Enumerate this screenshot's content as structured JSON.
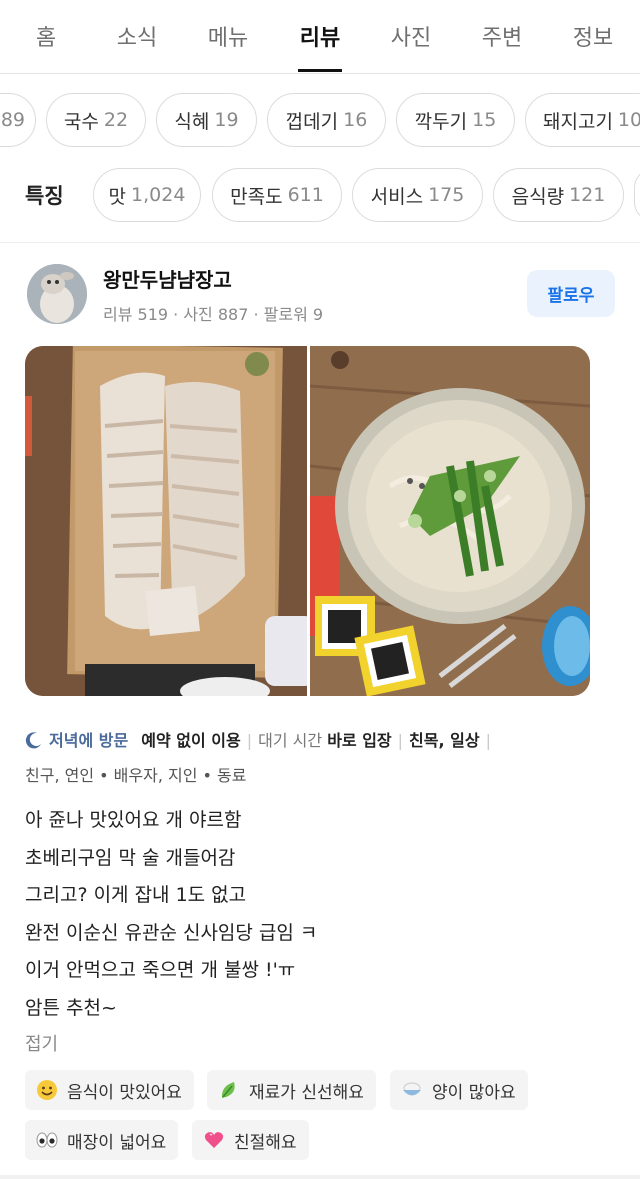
{
  "tabs": [
    {
      "label": "홈"
    },
    {
      "label": "소식"
    },
    {
      "label": "메뉴"
    },
    {
      "label": "리뷰",
      "active": true
    },
    {
      "label": "사진"
    },
    {
      "label": "주변"
    },
    {
      "label": "정보"
    }
  ],
  "menu_chips": [
    {
      "label": "",
      "count": "89"
    },
    {
      "label": "국수",
      "count": "22"
    },
    {
      "label": "식혜",
      "count": "19"
    },
    {
      "label": "껍데기",
      "count": "16"
    },
    {
      "label": "깍두기",
      "count": "15"
    },
    {
      "label": "돼지고기",
      "count": "10"
    }
  ],
  "features": {
    "label": "특징",
    "chips": [
      {
        "label": "맛",
        "count": "1,024"
      },
      {
        "label": "만족도",
        "count": "611"
      },
      {
        "label": "서비스",
        "count": "175"
      },
      {
        "label": "음식량",
        "count": "121"
      }
    ]
  },
  "review": {
    "author": {
      "name": "왕만두냠냠장고",
      "stats": "리뷰 519 · 사진 887 · 팔로워 9"
    },
    "follow_label": "팔로우",
    "visit": {
      "time": "저녁에 방문",
      "reservation": "예약 없이 이용",
      "wait_label": "대기 시간",
      "wait_value": "바로 입장",
      "purpose": "친목, 일상",
      "company": "친구, 연인 • 배우자, 지인 • 동료"
    },
    "text_lines": [
      "아 쥰나 맛있어요 개 야르함",
      "초베리구임 막 술 개들어감",
      "그리고? 이게 잡내 1도 없고",
      "완전 이순신 유관순 신사임당 급임 ㅋ",
      "이거 안먹으고 죽으면 개 불쌍 !'ㅠ",
      "암튼 추천~"
    ],
    "collapse_label": "접기",
    "keywords": [
      {
        "icon": "smile-emoji-icon",
        "label": "음식이 맛있어요"
      },
      {
        "icon": "leaf-icon",
        "label": "재료가 신선해요"
      },
      {
        "icon": "rice-bowl-icon",
        "label": "양이 많아요"
      },
      {
        "icon": "eyes-icon",
        "label": "매장이 넓어요"
      },
      {
        "icon": "heart-icon",
        "label": "친절해요"
      }
    ]
  },
  "colors": {
    "accent": "#1a73e8",
    "follow_bg": "#eaf3fd",
    "visit_time": "#4b6b9b"
  }
}
